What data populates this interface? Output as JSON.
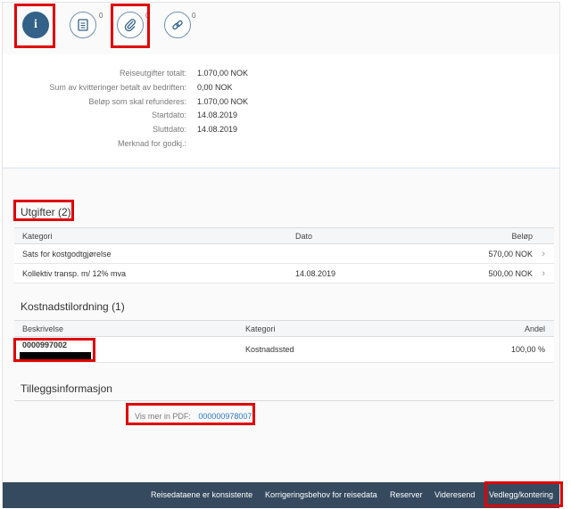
{
  "toolbar": {
    "info_label": "i",
    "attachments_count": "0",
    "receipts_count": "0",
    "links_count": "0"
  },
  "summary": [
    {
      "label": "Reiseutgifter totalt:",
      "value": "1.070,00  NOK"
    },
    {
      "label": "Sum av kvitteringer betalt av bedriften:",
      "value": "0,00  NOK"
    },
    {
      "label": "Beløp som skal refunderes:",
      "value": "1.070,00  NOK"
    },
    {
      "label": "Startdato:",
      "value": "14.08.2019"
    },
    {
      "label": "Sluttdato:",
      "value": "14.08.2019"
    },
    {
      "label": "Merknad for godkj.:",
      "value": ""
    }
  ],
  "utgifter": {
    "title": "Utgifter (2)",
    "headers": {
      "kategori": "Kategori",
      "dato": "Dato",
      "belop": "Beløp"
    },
    "rows": [
      {
        "kategori": "Sats for kostgodtgjørelse",
        "dato": "",
        "belop": "570,00  NOK"
      },
      {
        "kategori": "Kollektiv transp. m/ 12% mva",
        "dato": "14.08.2019",
        "belop": "500,00  NOK"
      }
    ]
  },
  "kostnad": {
    "title": "Kostnadstilordning (1)",
    "headers": {
      "beskrivelse": "Beskrivelse",
      "kategori": "Kategori",
      "andel": "Andel"
    },
    "rows": [
      {
        "beskrivelse": "0000997002",
        "kategori": "Kostnadssted",
        "andel": "100,00 %"
      }
    ]
  },
  "tillegg": {
    "title": "Tilleggsinformasjon",
    "pdf_label": "Vis mer in PDF:",
    "pdf_link": "000000978007"
  },
  "footer": {
    "b1": "Reisedataene er konsistente",
    "b2": "Korrigeringsbehov for reisedata",
    "b3": "Reserver",
    "b4": "Videresend",
    "b5": "Vedlegg/kontering"
  },
  "colors": {
    "accent": "#346187",
    "footer_bg": "#354a5f",
    "link": "#2a77c8",
    "highlight": "#e00000"
  }
}
